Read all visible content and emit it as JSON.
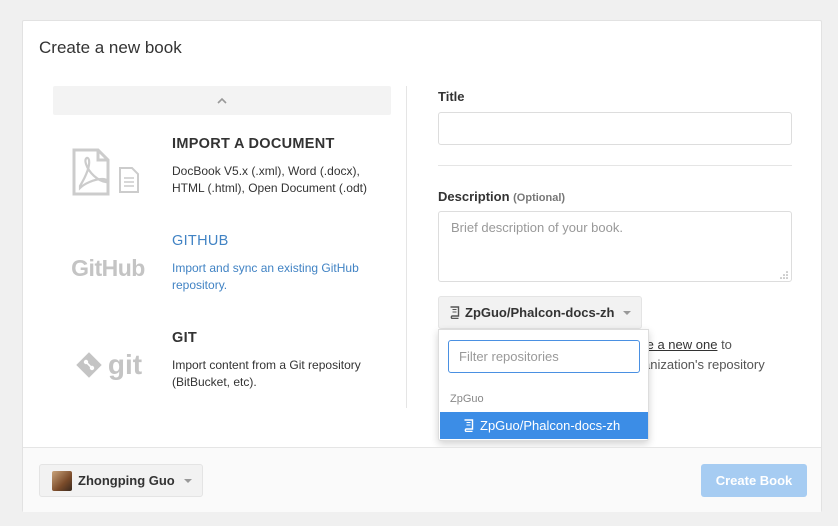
{
  "dialog": {
    "title": "Create a new book"
  },
  "sources": [
    {
      "heading": "IMPORT A DOCUMENT",
      "description": "DocBook V5.x (.xml), Word (.docx), HTML (.html), Open Document (.odt)",
      "icon": "document-import-icon"
    },
    {
      "heading": "GITHUB",
      "description": "Import and sync an existing GitHub repository.",
      "icon": "github-logo-icon",
      "logo_text": "GitHub"
    },
    {
      "heading": "GIT",
      "description": "Import content from a Git repository (BitBucket, etc).",
      "icon": "git-logo-icon",
      "logo_text": "git"
    }
  ],
  "form": {
    "title_label": "Title",
    "title_value": "",
    "description_label": "Description",
    "description_optional": "(Optional)",
    "description_placeholder": "Brief description of your book.",
    "repo_selected": "ZpGuo/Phalcon-docs-zh",
    "behind_line1_link": "te a new one",
    "behind_line1_rest": " to",
    "behind_line2": "anization's repository"
  },
  "repo_dropdown": {
    "filter_placeholder": "Filter repositories",
    "group_label": "ZpGuo",
    "items": [
      "ZpGuo/Phalcon-docs-zh"
    ]
  },
  "footer": {
    "user_name": "Zhongping Guo",
    "create_label": "Create Book"
  },
  "colors": {
    "accent": "#4183c4",
    "selected_item": "#3c8de6",
    "create_button_disabled": "#a6ccf2"
  }
}
